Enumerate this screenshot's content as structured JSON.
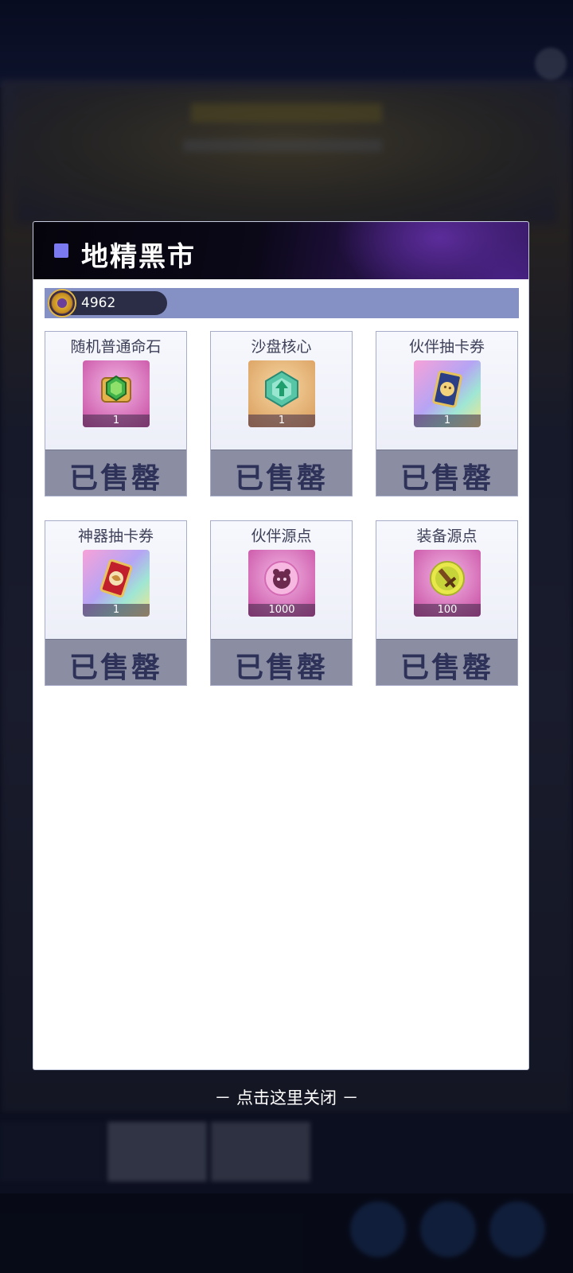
{
  "background": {
    "title": "",
    "tabs": [
      "",
      ""
    ]
  },
  "dialog": {
    "title": "地精黑市",
    "currency": {
      "icon": "gold-coin-icon",
      "amount": "4962"
    },
    "items": [
      {
        "name": "随机普通命石",
        "quantity": "1",
        "icon": "green-gem-icon",
        "status": "已售罄"
      },
      {
        "name": "沙盘核心",
        "quantity": "1",
        "icon": "sandbox-core-icon",
        "status": "已售罄"
      },
      {
        "name": "伙伴抽卡券",
        "quantity": "1",
        "icon": "partner-card-icon",
        "status": "已售罄"
      },
      {
        "name": "神器抽卡券",
        "quantity": "1",
        "icon": "artifact-card-icon",
        "status": "已售罄"
      },
      {
        "name": "伙伴源点",
        "quantity": "1000",
        "icon": "partner-orb-icon",
        "status": "已售罄"
      },
      {
        "name": "装备源点",
        "quantity": "100",
        "icon": "equipment-orb-icon",
        "status": "已售罄"
      }
    ]
  },
  "close_hint": "－ 点击这里关闭 －"
}
